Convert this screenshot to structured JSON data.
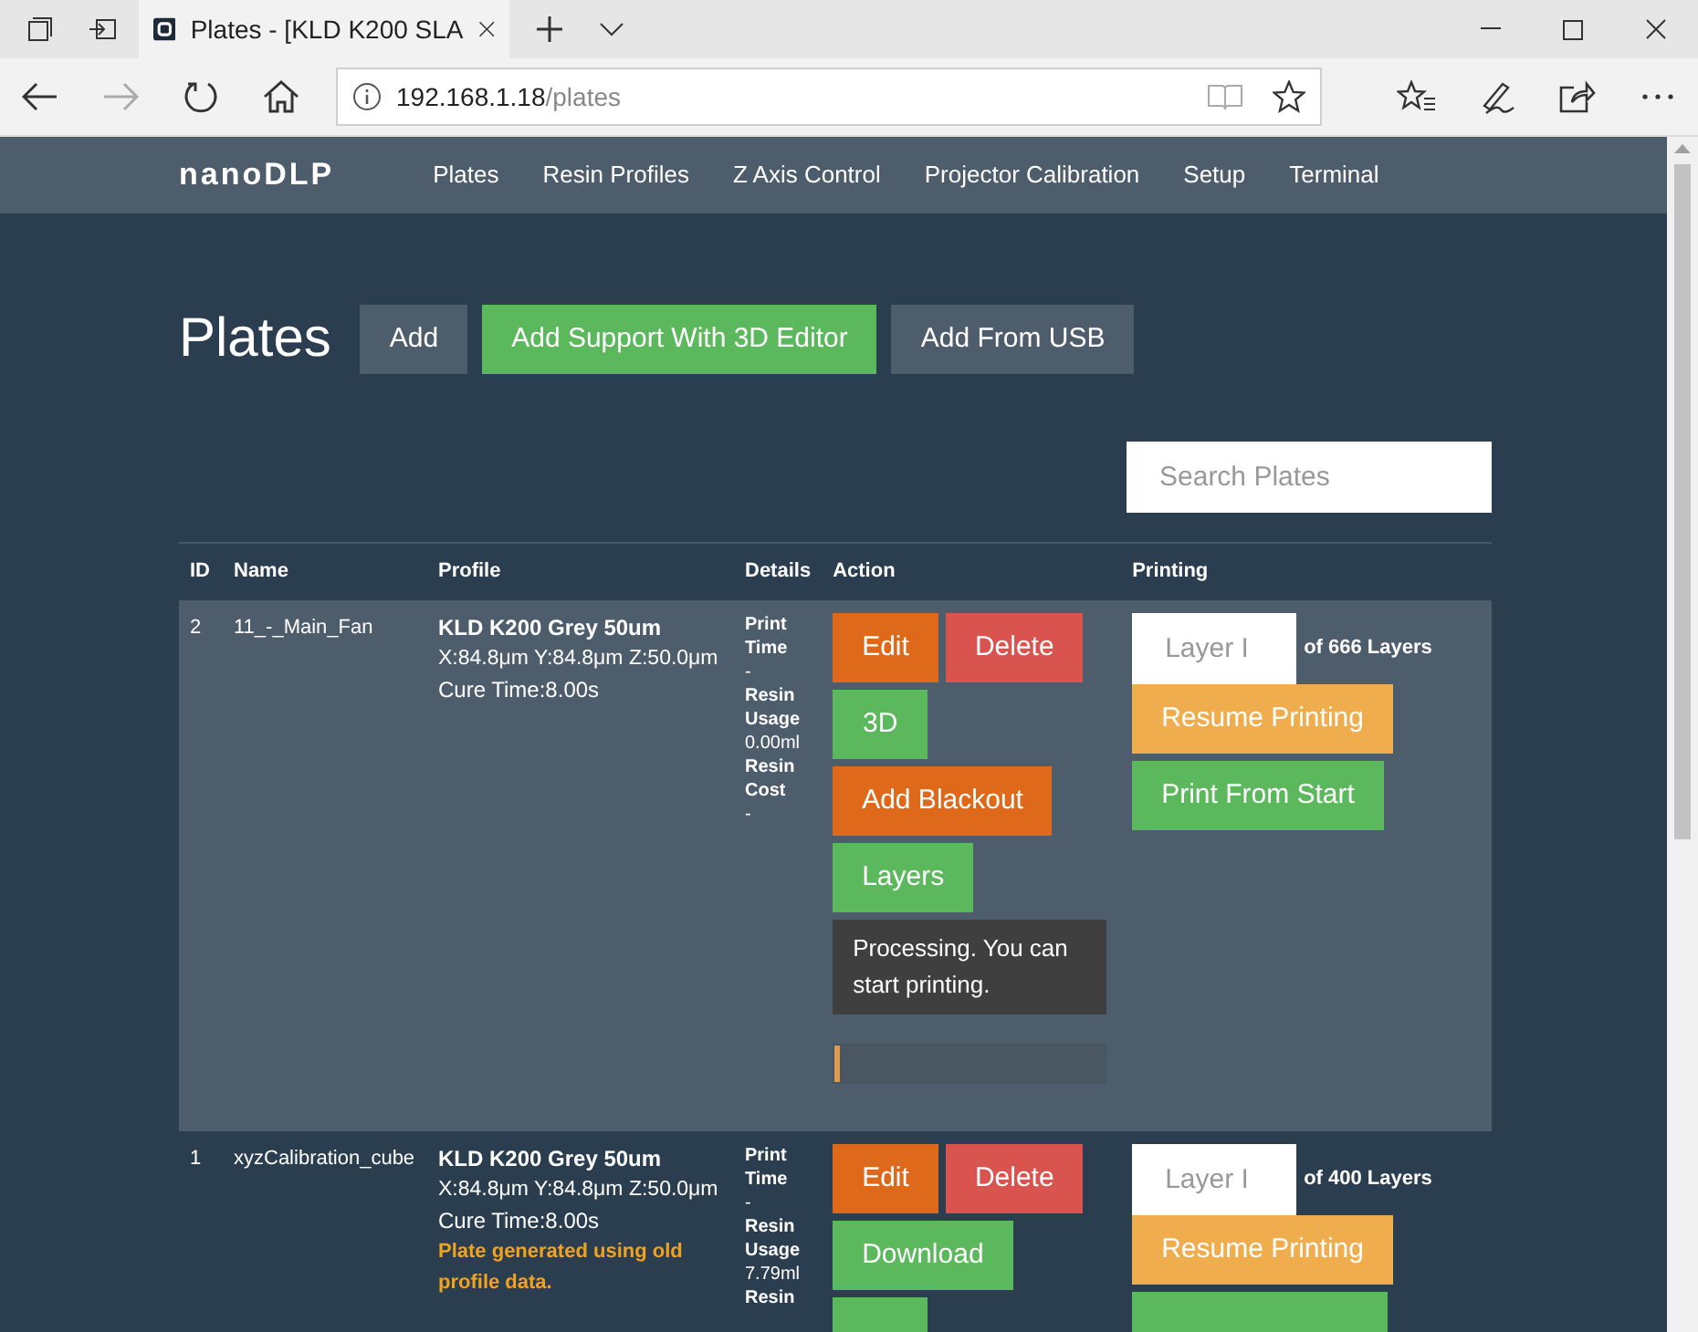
{
  "browser": {
    "tab_title": "Plates - [KLD K200 SLA",
    "url_host": "192.168.1.18",
    "url_path": "/plates"
  },
  "navbar": {
    "brand": "nanoDLP",
    "items": [
      "Plates",
      "Resin Profiles",
      "Z Axis Control",
      "Projector Calibration",
      "Setup",
      "Terminal"
    ]
  },
  "header": {
    "title": "Plates",
    "buttons": [
      {
        "label": "Add",
        "kind": "default"
      },
      {
        "label": "Add Support With 3D Editor",
        "kind": "success"
      },
      {
        "label": "Add From USB",
        "kind": "default"
      }
    ]
  },
  "search": {
    "placeholder": "Search Plates"
  },
  "table": {
    "columns": [
      "ID",
      "Name",
      "Profile",
      "Details",
      "Action",
      "Printing"
    ],
    "rows": [
      {
        "selected": true,
        "id": "2",
        "name": "11_-_Main_Fan",
        "profile": "KLD K200 Grey 50um",
        "specs": "X:84.8μm Y:84.8μm Z:50.0μm",
        "cure": "Cure Time:8.00s",
        "details": [
          {
            "label": "Print Time",
            "value": "-"
          },
          {
            "label": "Resin Usage",
            "value": "0.00ml"
          },
          {
            "label": "Resin Cost",
            "value": "-"
          }
        ],
        "actions": [
          {
            "label": "Edit",
            "kind": "warning"
          },
          {
            "label": "Delete",
            "kind": "danger"
          },
          {
            "label": "3D",
            "kind": "success"
          },
          {
            "label": "Add Blackout",
            "kind": "warning"
          },
          {
            "label": "Layers",
            "kind": "success"
          }
        ],
        "message": "Processing. You can start printing.",
        "progress": {
          "level": 0.02
        },
        "layer_placeholder": "Layer I",
        "layer_total": "of 666 Layers",
        "print_buttons": [
          {
            "label": "Resume Printing",
            "kind": "resume"
          },
          {
            "label": "Print From Start",
            "kind": "success"
          }
        ]
      },
      {
        "selected": false,
        "id": "1",
        "name": "xyzCalibration_cube",
        "profile": "KLD K200 Grey 50um",
        "specs": "X:84.8μm Y:84.8μm Z:50.0μm",
        "cure": "Cure Time:8.00s",
        "warning": "Plate generated using old profile data.",
        "details": [
          {
            "label": "Print Time",
            "value": "-"
          },
          {
            "label": "Resin Usage",
            "value": "7.79ml"
          },
          {
            "label": "Resin"
          }
        ],
        "actions": [
          {
            "label": "Edit",
            "kind": "warning"
          },
          {
            "label": "Delete",
            "kind": "danger"
          },
          {
            "label": "Download",
            "kind": "success"
          },
          {
            "kind": "success"
          }
        ],
        "layer_placeholder": "Layer I",
        "layer_total": "of 400 Layers",
        "print_buttons": [
          {
            "label": "Resume Printing",
            "kind": "resume"
          },
          {
            "kind": "success"
          }
        ]
      }
    ]
  }
}
